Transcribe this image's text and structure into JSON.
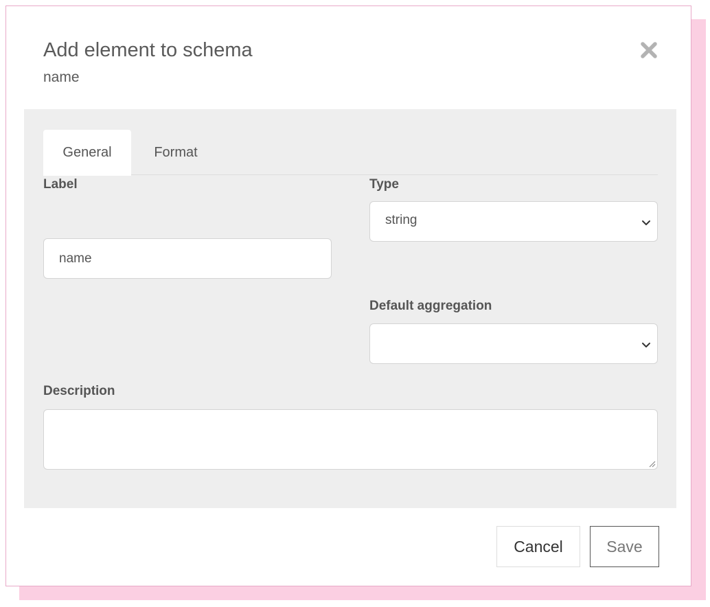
{
  "dialog": {
    "title": "Add element to schema",
    "subtitle": "name",
    "close_icon": "close-x-icon"
  },
  "tabs": [
    {
      "label": "General",
      "active": true
    },
    {
      "label": "Format",
      "active": false
    }
  ],
  "form": {
    "label": {
      "title": "Label",
      "value": "name"
    },
    "type": {
      "title": "Type",
      "selected": "string"
    },
    "default_aggregation": {
      "title": "Default aggregation",
      "selected": ""
    },
    "description": {
      "title": "Description",
      "value": ""
    }
  },
  "footer": {
    "cancel_label": "Cancel",
    "save_label": "Save"
  },
  "colors": {
    "accent_pink": "#fbcfe2",
    "panel_bg": "#eeeeee",
    "text": "#555555"
  }
}
